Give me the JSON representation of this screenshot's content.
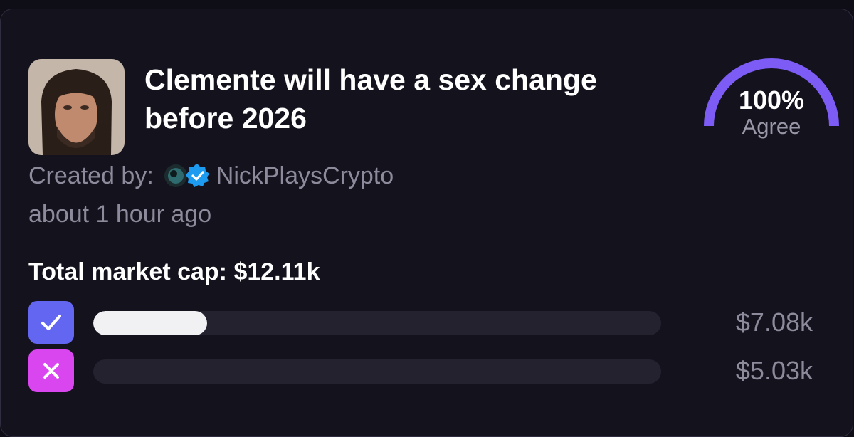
{
  "market": {
    "title": "Clemente will have a sex change before 2026",
    "created_by_label": "Created by:",
    "creator_name": "NickPlaysCrypto",
    "creator_verified": true,
    "time_ago": "about 1 hour ago",
    "market_cap_text": "Total market cap: $12.11k"
  },
  "gauge": {
    "percent_text": "100%",
    "label": "Agree",
    "level": 1.0,
    "color": "#7c5cf5"
  },
  "options": [
    {
      "name": "yes",
      "icon": "check-icon",
      "value_text": "$7.08k",
      "bar_fill_fraction": 0.2,
      "color": "#6366f1"
    },
    {
      "name": "no",
      "icon": "x-icon",
      "value_text": "$5.03k",
      "bar_fill_fraction": 0.0,
      "color": "#d946ef"
    }
  ],
  "colors": {
    "background": "#13121d",
    "track": "#24222f",
    "fill": "#f1f1f4",
    "muted_text": "#8d8b9b",
    "verified_badge": "#1d9bf0"
  }
}
